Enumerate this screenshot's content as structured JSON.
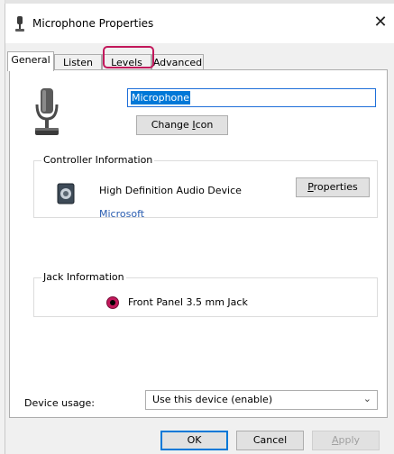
{
  "window": {
    "title": "Microphone Properties",
    "icon": "microphone-icon",
    "close_glyph": "✕"
  },
  "tabs": [
    {
      "label": "General",
      "active": true
    },
    {
      "label": "Listen",
      "active": false
    },
    {
      "label": "Levels",
      "active": false,
      "highlighted": true
    },
    {
      "label": "Advanced",
      "active": false
    }
  ],
  "device": {
    "name_value": "Microphone",
    "change_icon_pre": "Change ",
    "change_icon_mnemonic": "I",
    "change_icon_post": "con"
  },
  "controller": {
    "group_label": "Controller Information",
    "name": "High Definition Audio Device",
    "vendor": "Microsoft",
    "properties_mnemonic": "P",
    "properties_rest": "roperties"
  },
  "jack": {
    "group_label": "Jack Information",
    "text": "Front Panel 3.5 mm Jack",
    "color": "#c2185b"
  },
  "usage": {
    "label": "Device usage:",
    "selected": "Use this device (enable)"
  },
  "footer": {
    "ok": "OK",
    "cancel": "Cancel",
    "apply_mnemonic": "A",
    "apply_rest": "pply"
  },
  "colors": {
    "highlight": "#c2185b",
    "selection": "#0078d7",
    "link": "#2a5db0"
  }
}
